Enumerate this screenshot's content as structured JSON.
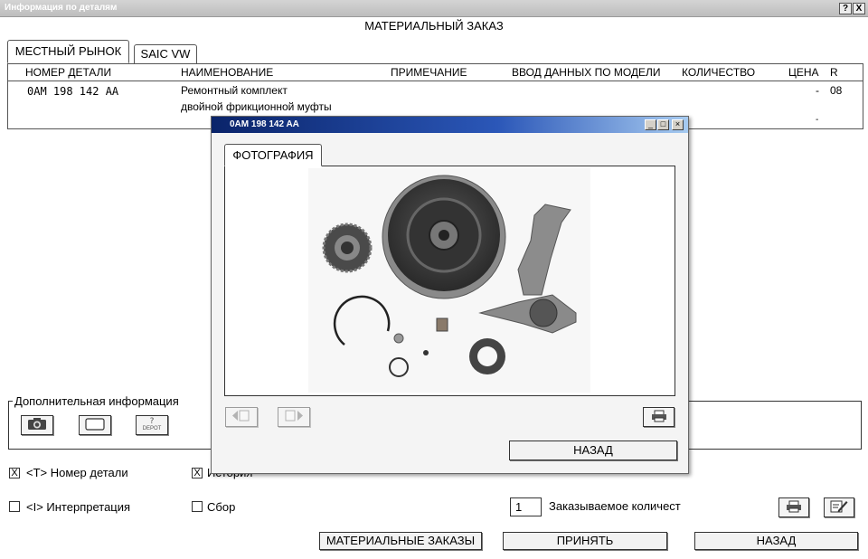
{
  "window": {
    "title": "Информация по деталям",
    "help_label": "?",
    "close_label": "X"
  },
  "header": {
    "title": "МАТЕРИАЛЬНЫЙ ЗАКАЗ"
  },
  "tabs": [
    {
      "label": "МЕСТНЫЙ РЫНОК"
    },
    {
      "label": "SAIC VW"
    }
  ],
  "columns": [
    "НОМЕР ДЕТАЛИ",
    "НАИМЕНОВАНИЕ",
    "ПРИМЕЧАНИЕ",
    "ВВОД ДАННЫХ ПО МОДЕЛИ",
    "КОЛИЧЕСТВО",
    "ЦЕНА",
    "R"
  ],
  "rows": [
    {
      "part_number": "0AM 198 142 AA",
      "name_line1": "Ремонтный комплект",
      "name_line2": "двойной фрикционной муфты",
      "price_1": "-",
      "price_2": "-",
      "r": "08"
    }
  ],
  "additional_info": {
    "title": "Дополнительная информация",
    "depot_q": "?",
    "depot_label": "DEPOT"
  },
  "options": {
    "part_number_label": "<T> Номер детали",
    "history_label": "История",
    "interpretation_label": "<I> Интерпретация",
    "collection_label": "Сбор",
    "part_number_checked": "X",
    "history_checked": "X"
  },
  "quantity": {
    "value": "1",
    "label": "Заказываемое количест"
  },
  "buttons": {
    "material_orders": "МАТЕРИАЛЬНЫЕ ЗАКАЗЫ",
    "accept": "ПРИНЯТЬ",
    "back": "НАЗАД"
  },
  "popup": {
    "title": "0AM 198 142 AA",
    "tab_label": "ФОТОГРАФИЯ",
    "back_label": "НАЗАД",
    "min_label": "_",
    "max_label": "□",
    "close_label": "×"
  },
  "colors": {
    "popup_title": "#0a246a",
    "frame_border": "#333333"
  }
}
